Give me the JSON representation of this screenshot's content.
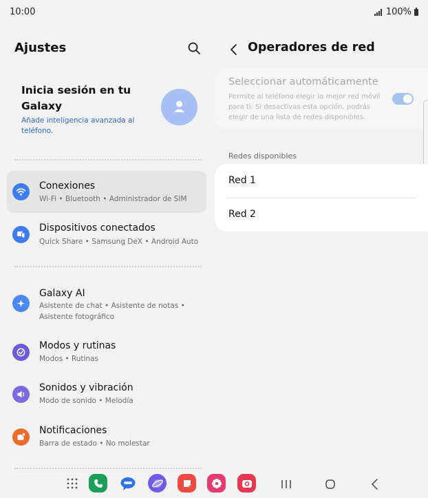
{
  "status": {
    "time": "10:00",
    "battery": "100%"
  },
  "left": {
    "title": "Ajustes",
    "account": {
      "title": "Inicia sesión en tu Galaxy",
      "subtitle": "Añade inteligencia avanzada al teléfono."
    },
    "items": [
      {
        "title": "Conexiones",
        "sub": "Wi-Fi  •  Bluetooth  •  Administrador de SIM",
        "icon": "wifi-icon",
        "color": "#3d7bf0",
        "selected": true
      },
      {
        "title": "Dispositivos conectados",
        "sub": "Quick Share  •  Samsung DeX  •  Android Auto",
        "icon": "connected-devices-icon",
        "color": "#3d7bf0"
      },
      {
        "title": "Galaxy AI",
        "sub": "Asistente de chat  •  Asistente de notas  •  Asistente fotográfico",
        "icon": "sparkle-icon",
        "color": "#4b88f2"
      },
      {
        "title": "Modos y rutinas",
        "sub": "Modos  •  Rutinas",
        "icon": "check-circle-icon",
        "color": "#6b5bd8"
      },
      {
        "title": "Sonidos y vibración",
        "sub": "Modo de sonido  •  Melodía",
        "icon": "speaker-icon",
        "color": "#7b6ae0"
      },
      {
        "title": "Notificaciones",
        "sub": "Barra de estado  •  No molestar",
        "icon": "notification-icon",
        "color": "#f06a2e"
      }
    ]
  },
  "right": {
    "title": "Operadores de red",
    "auto_select": {
      "title": "Seleccionar automáticamente",
      "description": "Permite al teléfono elegir la mejor red móvil para ti. Si desactivas esta opción, podrás elegir de una lista de redes disponibles.",
      "enabled": true
    },
    "section_label": "Redes disponibles",
    "networks": [
      "Red 1",
      "Red 2"
    ]
  },
  "navbar": {
    "apps": [
      {
        "name": "apps-grid-icon",
        "color": "#555555"
      },
      {
        "name": "phone-app-icon",
        "color": "#1a9e58"
      },
      {
        "name": "messages-app-icon",
        "color": "#2f72e6"
      },
      {
        "name": "internet-app-icon",
        "color": "#6c5ce7"
      },
      {
        "name": "notes-app-icon",
        "color": "#ef4b44"
      },
      {
        "name": "gallery-app-icon",
        "color": "#e53a6f"
      },
      {
        "name": "camera-app-icon",
        "color": "#e5384f"
      }
    ]
  }
}
